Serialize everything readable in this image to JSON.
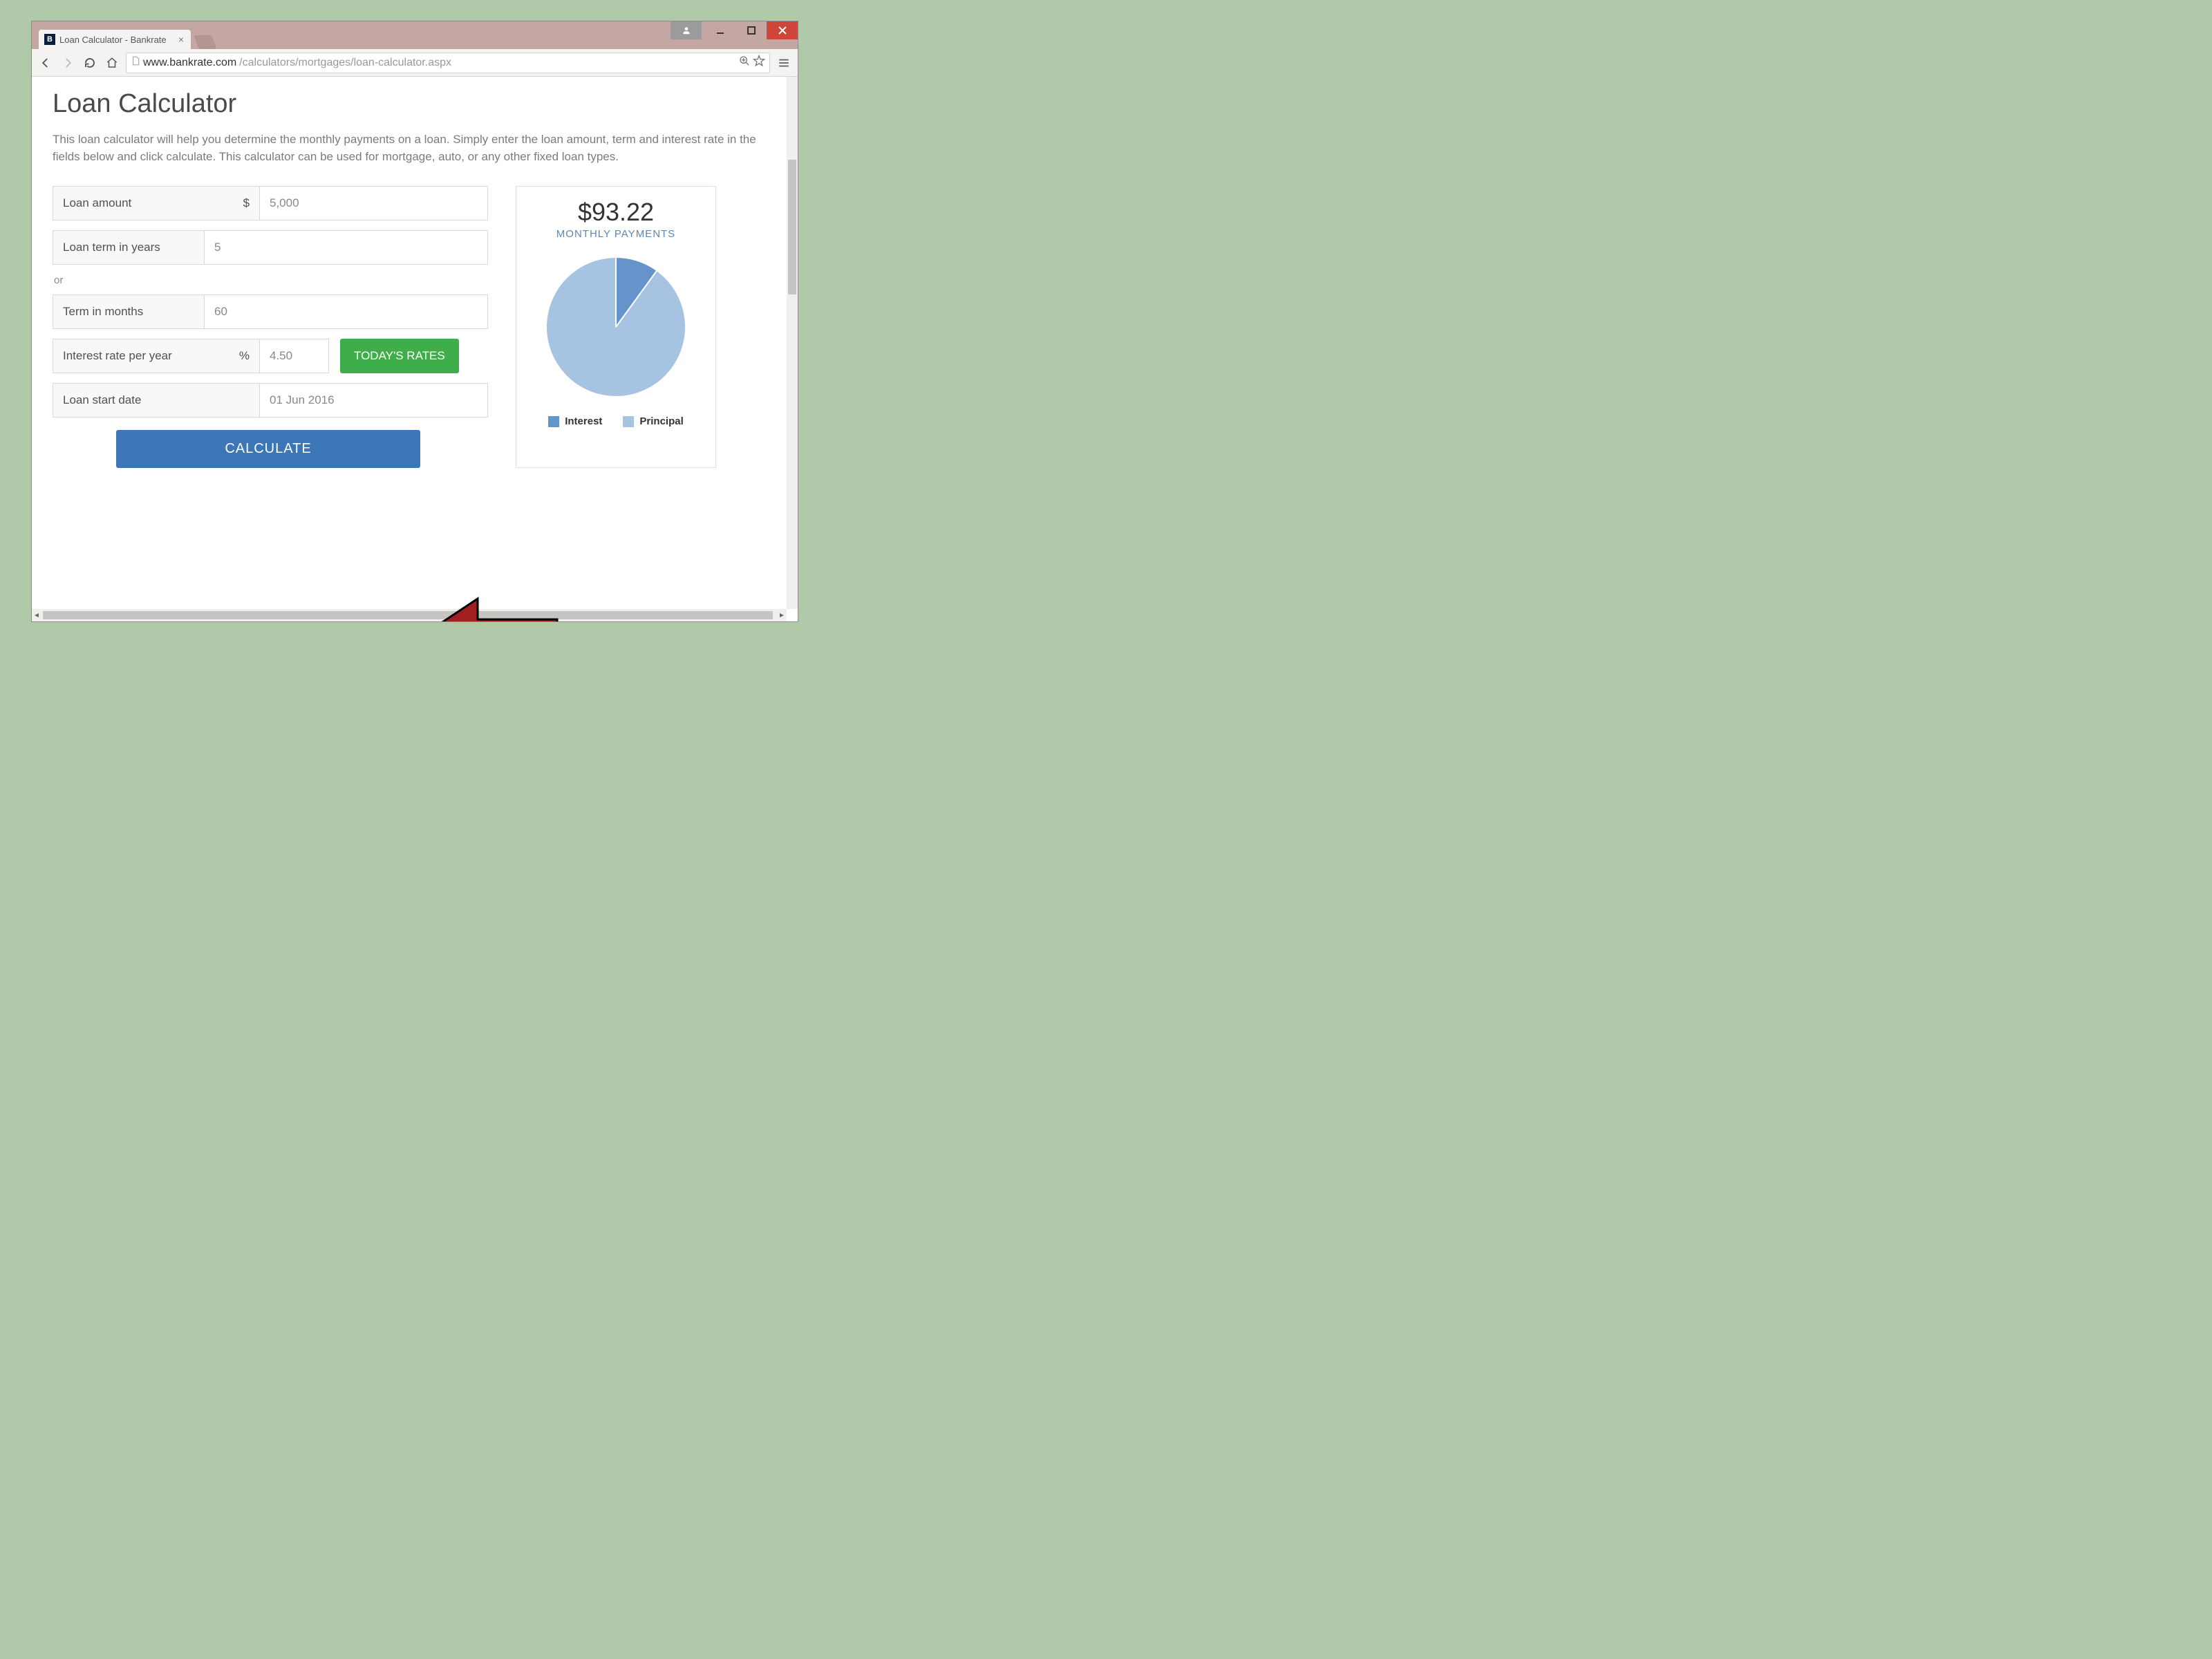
{
  "browser": {
    "tab_title": "Loan Calculator - Bankrate",
    "favicon_letter": "B",
    "url_host": "www.bankrate.com",
    "url_path": "/calculators/mortgages/loan-calculator.aspx"
  },
  "page": {
    "title": "Loan Calculator",
    "description": "This loan calculator will help you determine the monthly payments on a loan. Simply enter the loan amount, term and interest rate in the fields below and click calculate. This calculator can be used for mortgage, auto, or any other fixed loan types."
  },
  "form": {
    "loan_amount": {
      "label": "Loan amount",
      "suffix": "$",
      "value": "5,000"
    },
    "loan_term_years": {
      "label": "Loan term in years",
      "value": "5"
    },
    "or_text": "or",
    "term_months": {
      "label": "Term in months",
      "value": "60"
    },
    "interest_rate": {
      "label": "Interest rate per year",
      "suffix": "%",
      "value": "4.50",
      "rates_button": "TODAY'S RATES"
    },
    "start_date": {
      "label": "Loan start date",
      "value": "01 Jun 2016"
    },
    "calculate_button": "CALCULATE"
  },
  "result": {
    "amount": "$93.22",
    "caption": "MONTHLY PAYMENTS",
    "legend": {
      "interest": "Interest",
      "principal": "Principal"
    }
  },
  "chart_data": {
    "type": "pie",
    "title": "Monthly payment breakdown",
    "series": [
      {
        "name": "Interest",
        "value": 10,
        "color": "#6693ca"
      },
      {
        "name": "Principal",
        "value": 90,
        "color": "#a6c3e2"
      }
    ]
  },
  "colors": {
    "accent_blue": "#3d76b6",
    "accent_green": "#3fae4a",
    "pie_interest": "#6693ca",
    "pie_principal": "#a6c3e2"
  }
}
